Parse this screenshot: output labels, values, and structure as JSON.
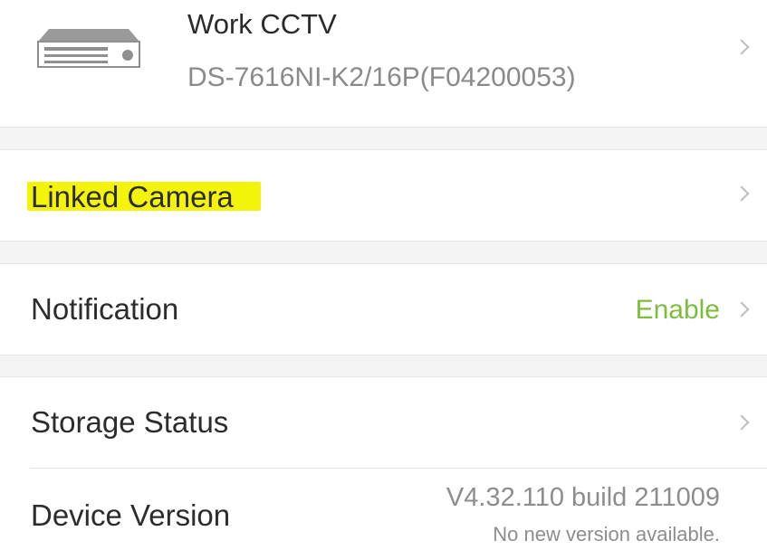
{
  "device": {
    "name": "Work CCTV",
    "model": "DS-7616NI-K2/16P(F04200053)",
    "icon": "nvr-recorder-icon"
  },
  "menu": {
    "linked_camera": {
      "label": "Linked Camera",
      "highlight_color": "#f4f40a"
    },
    "notification": {
      "label": "Notification",
      "value": "Enable",
      "value_color": "#7cbd3e"
    },
    "storage_status": {
      "label": "Storage Status"
    },
    "device_version": {
      "label": "Device Version",
      "value": "V4.32.110 build 211009",
      "note": "No new version available."
    }
  }
}
